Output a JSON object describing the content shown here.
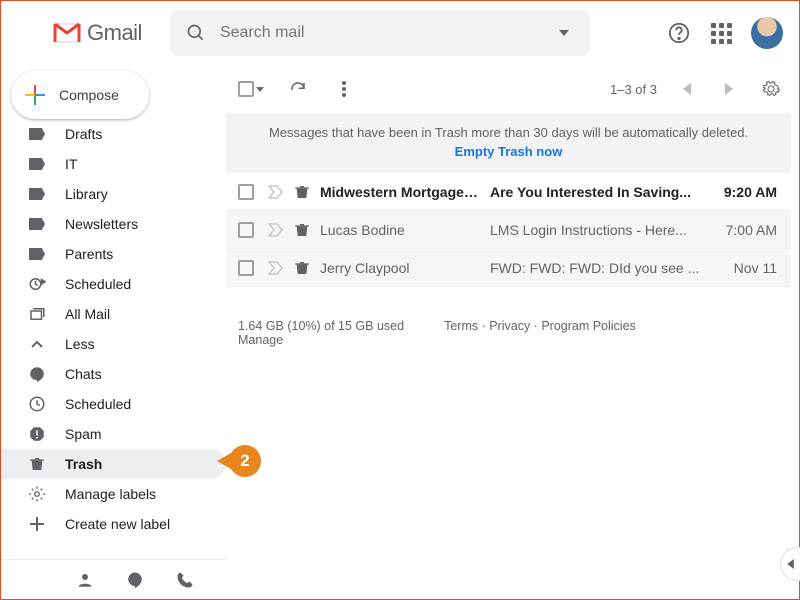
{
  "header": {
    "app_name": "Gmail",
    "search_placeholder": "Search mail"
  },
  "compose_label": "Compose",
  "sidebar": {
    "items": [
      {
        "label": "Drafts",
        "icon": "label"
      },
      {
        "label": "IT",
        "icon": "label"
      },
      {
        "label": "Library",
        "icon": "label"
      },
      {
        "label": "Newsletters",
        "icon": "label"
      },
      {
        "label": "Parents",
        "icon": "label"
      },
      {
        "label": "Scheduled",
        "icon": "clock-send"
      },
      {
        "label": "All Mail",
        "icon": "stack"
      },
      {
        "label": "Less",
        "icon": "chevron-up"
      },
      {
        "label": "Chats",
        "icon": "chat"
      },
      {
        "label": "Scheduled",
        "icon": "clock"
      },
      {
        "label": "Spam",
        "icon": "spam"
      },
      {
        "label": "Trash",
        "icon": "trash",
        "selected": true
      },
      {
        "label": "Manage labels",
        "icon": "gear"
      },
      {
        "label": "Create new label",
        "icon": "plus"
      }
    ]
  },
  "toolbar": {
    "count_text": "1–3 of 3"
  },
  "banner": {
    "text": "Messages that have been in Trash more than 30 days will be automatically deleted.",
    "link": "Empty Trash now"
  },
  "emails": [
    {
      "sender": "Midwestern Mortgage and",
      "subject": "Are You Interested In Saving...",
      "date": "9:20 AM",
      "unread": true
    },
    {
      "sender": "Lucas Bodine",
      "subject": "LMS Login Instructions - Here...",
      "date": "7:00 AM",
      "unread": false
    },
    {
      "sender": "Jerry Claypool",
      "subject": "FWD: FWD: FWD: DId you see ...",
      "date": "Nov 11",
      "unread": false
    }
  ],
  "footer": {
    "storage": "1.64 GB (10%) of 15 GB used",
    "manage": "Manage",
    "links": {
      "terms": "Terms",
      "privacy": "Privacy",
      "policies": "Program Policies"
    }
  },
  "callout_number": "2"
}
